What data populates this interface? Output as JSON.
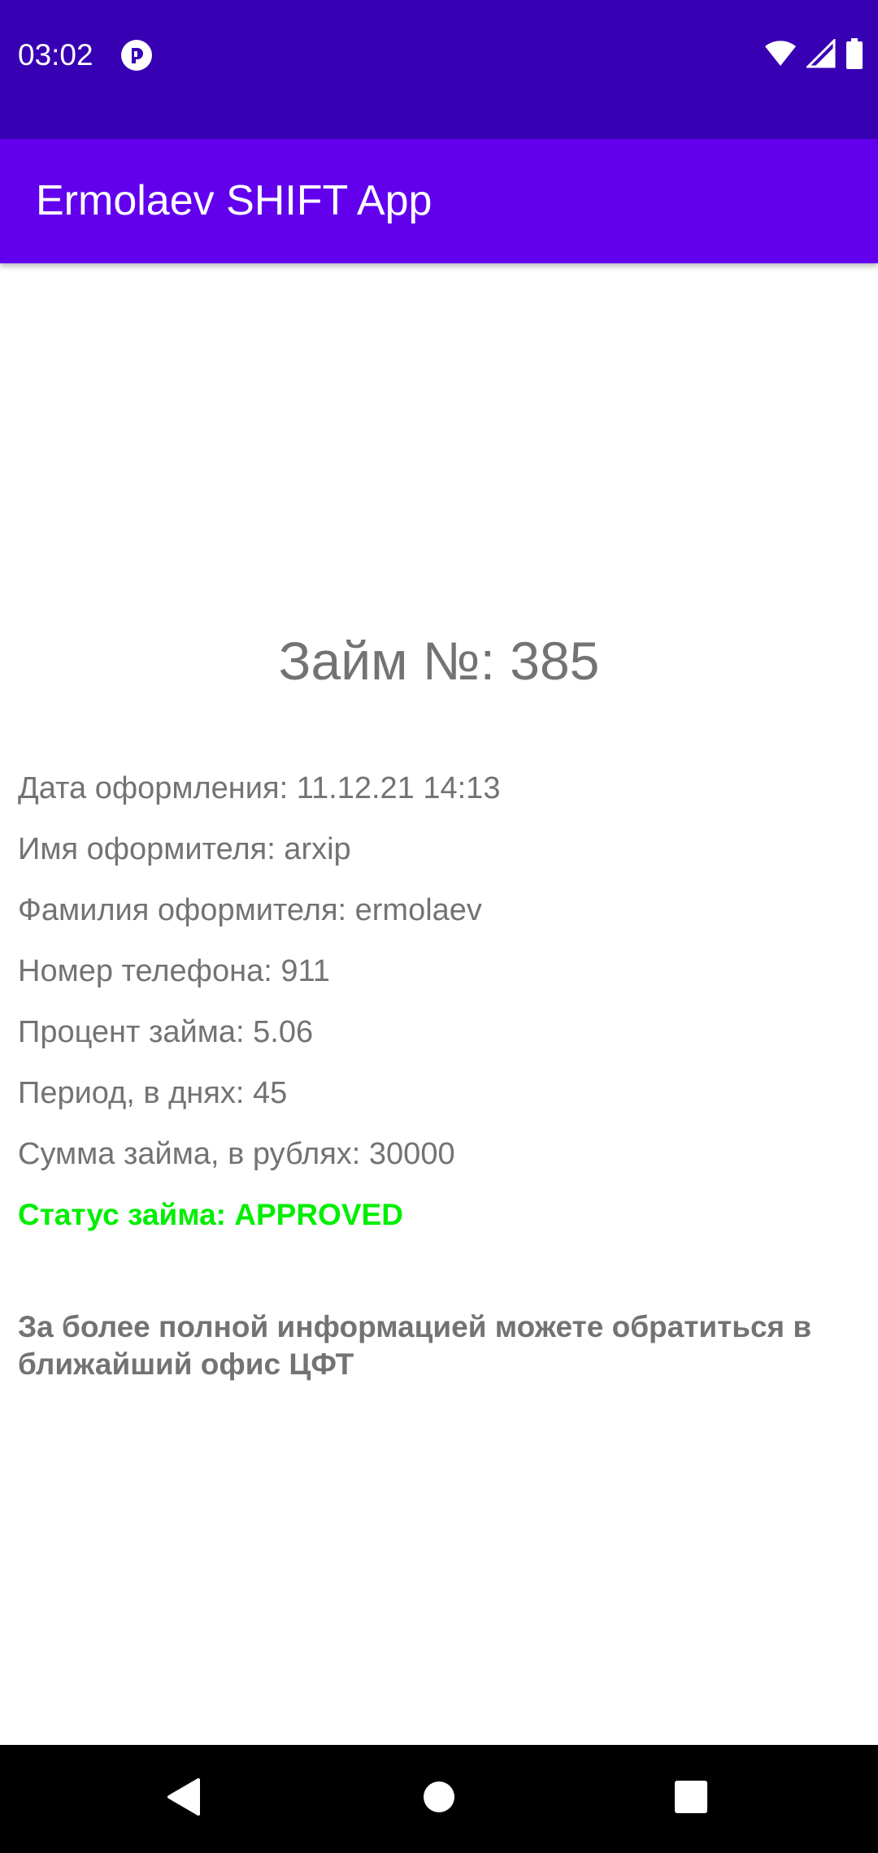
{
  "status_bar": {
    "time": "03:02",
    "notification_icon": "app-notification-icon",
    "wifi_icon": "wifi-icon",
    "signal_icon": "signal-icon",
    "battery_icon": "battery-icon",
    "background_color": "#3700b3"
  },
  "app_bar": {
    "title": "Ermolaev SHIFT App",
    "background_color": "#6200ee"
  },
  "loan": {
    "title": "Займ №: 385",
    "details": [
      "Дата оформления: 11.12.21 14:13",
      "Имя оформителя: arxip",
      "Фамилия оформителя: ermolaev",
      "Номер телефона: 911",
      "Процент займа: 5.06",
      "Период, в днях: 45",
      "Сумма займа, в рублях: 30000"
    ],
    "status": "Статус займа: APPROVED",
    "status_color": "#00ee00",
    "info": "За более полной информацией можете обратиться в ближайший офис ЦФТ"
  },
  "nav_bar": {
    "back_icon": "back-triangle-icon",
    "home_icon": "home-circle-icon",
    "recents_icon": "recents-square-icon"
  }
}
